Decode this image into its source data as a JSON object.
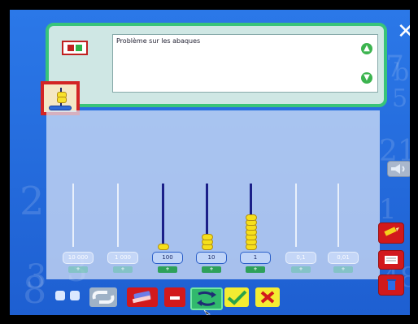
{
  "window": {
    "close_label": "✕"
  },
  "instructions": {
    "text": "Problème sur les abaques"
  },
  "abacus": {
    "columns": [
      {
        "label": "10 000",
        "beads": 0,
        "active": false
      },
      {
        "label": "1 000",
        "beads": 0,
        "active": false
      },
      {
        "label": "100",
        "beads": 1,
        "active": true
      },
      {
        "label": "10",
        "beads": 3,
        "active": true
      },
      {
        "label": "1",
        "beads": 7,
        "active": true
      },
      {
        "label": "0,1",
        "beads": 0,
        "active": false
      },
      {
        "label": "0,01",
        "beads": 0,
        "active": false
      }
    ],
    "bottom_small": [
      "",
      ""
    ]
  },
  "background_digits": [
    "2",
    "3",
    "3",
    "8",
    "7",
    "5",
    "21",
    "1",
    "b",
    "48",
    "16"
  ],
  "icons": {
    "close": "close-icon",
    "scroll_up": "arrow-up-icon",
    "scroll_down": "arrow-down-icon",
    "speaker": "speaker-icon",
    "pencil": "pencil-icon",
    "notes": "notes-icon",
    "bin": "trash-icon",
    "eraser": "eraser-icon",
    "reset": "reset-icon",
    "check": "check-icon",
    "cancel": "cancel-icon"
  },
  "colors": {
    "background": "#2b78e8",
    "panel_border": "#39c47a",
    "bead": "#f6df1a",
    "rod": "#1b1f88"
  }
}
